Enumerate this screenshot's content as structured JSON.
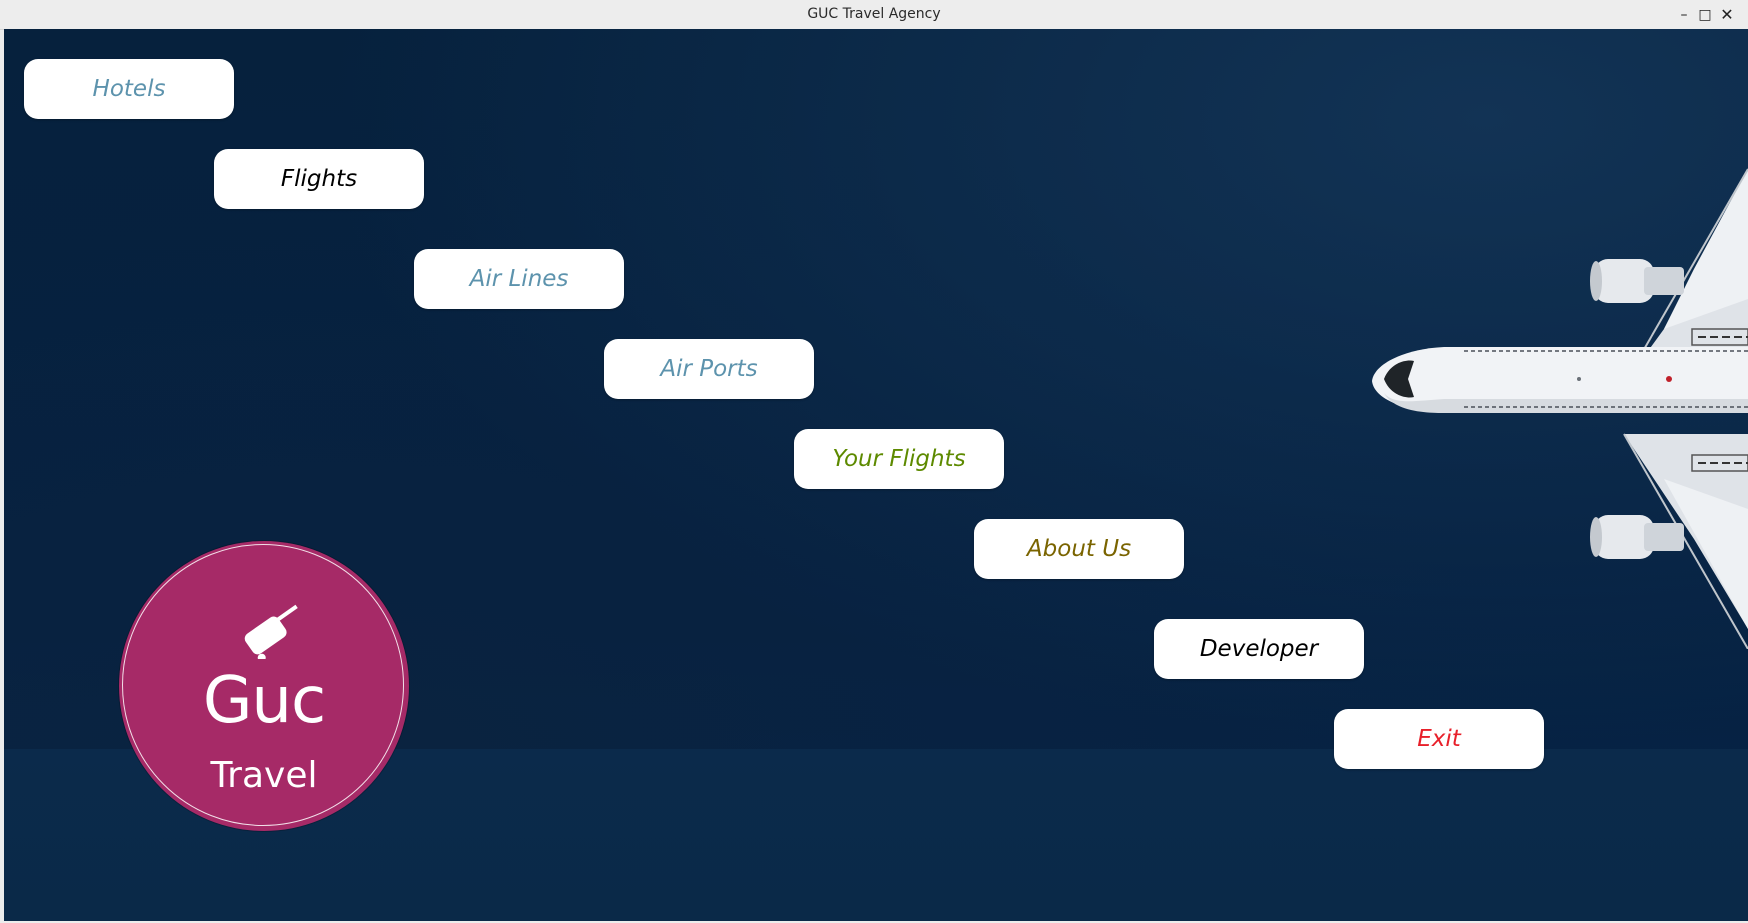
{
  "window": {
    "title": "GUC Travel Agency",
    "controls": {
      "minimize_icon": "minimize-icon",
      "maximize_icon": "maximize-icon",
      "close_icon": "close-icon"
    }
  },
  "menu": {
    "hotels": {
      "label": "Hotels",
      "color": "#5d93ad"
    },
    "flights": {
      "label": "Flights",
      "color": "#000000"
    },
    "air_lines": {
      "label": "Air Lines",
      "color": "#5d93ad"
    },
    "air_ports": {
      "label": "Air Ports",
      "color": "#5d93ad"
    },
    "your_flights": {
      "label": "Your Flights",
      "color": "#5d8a00"
    },
    "about_us": {
      "label": "About Us",
      "color": "#7a6400"
    },
    "developer": {
      "label": "Developer",
      "color": "#000000"
    },
    "exit": {
      "label": "Exit",
      "color": "#e8202a"
    }
  },
  "logo": {
    "line1": "Guc",
    "line2": "Travel",
    "icon": "suitcase-icon",
    "background": "#a62a67"
  },
  "background": {
    "image": "airplane-top-view",
    "color": "#06213d"
  }
}
